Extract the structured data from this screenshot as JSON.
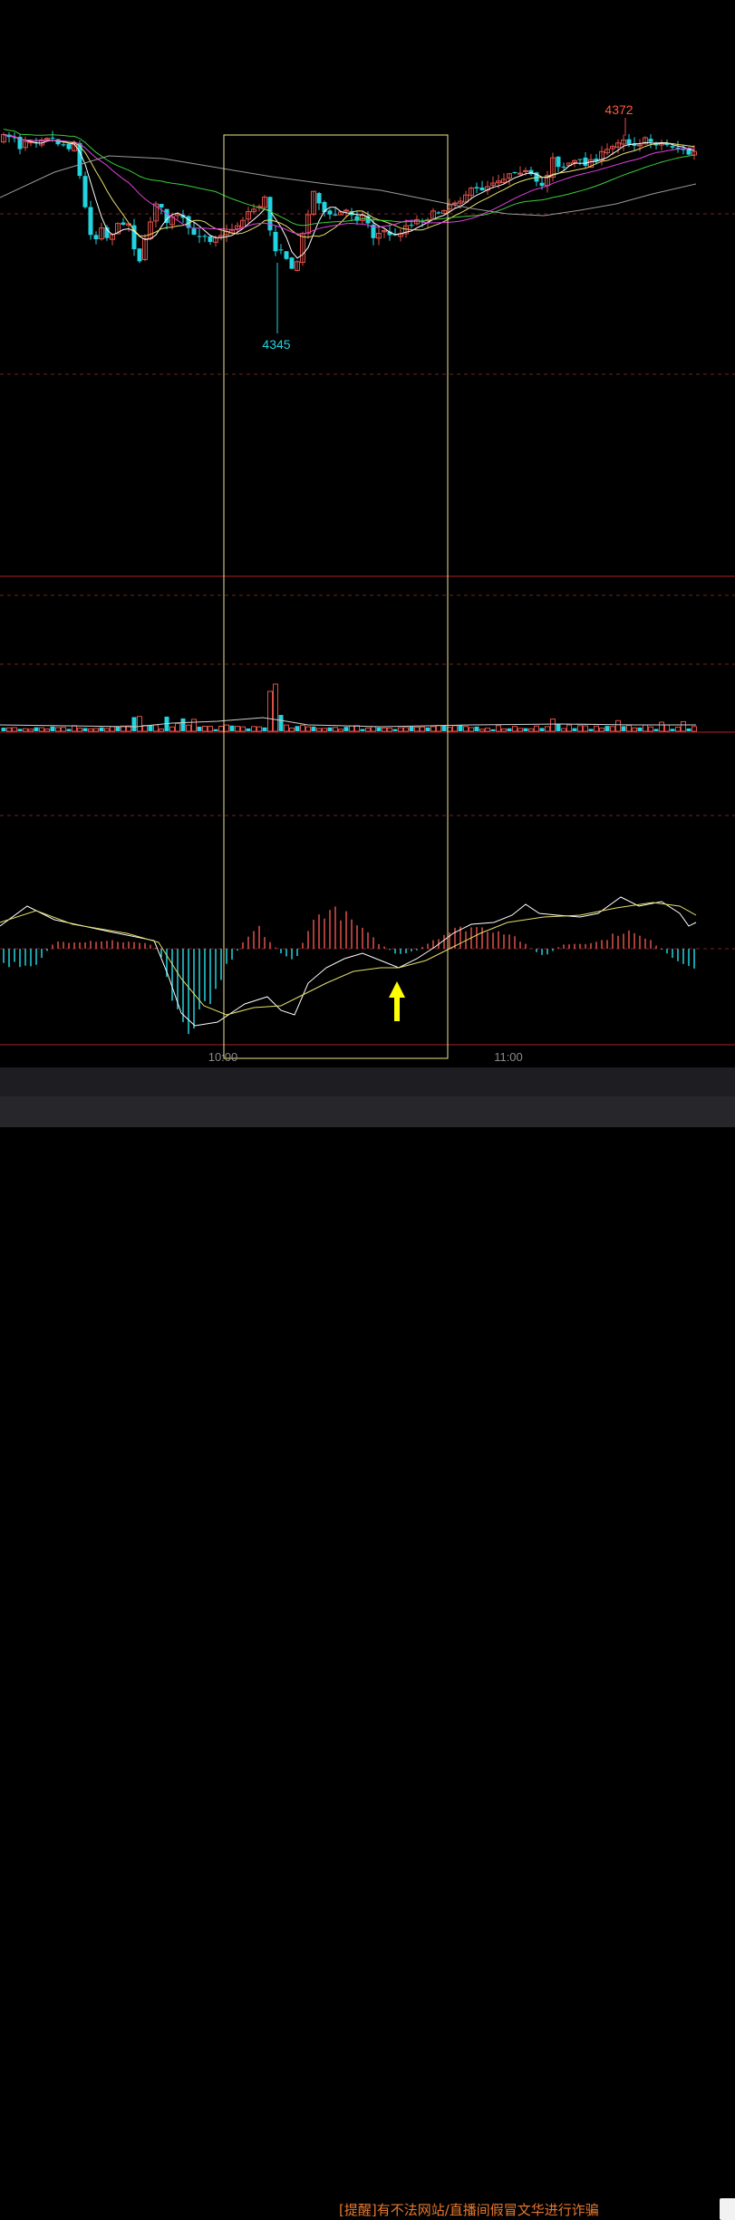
{
  "colors": {
    "background": "#000000",
    "up": "#e0504a",
    "down": "#22d3e0",
    "ma5": "#ffffff",
    "ma10": "#e6e06a",
    "ma20": "#e040e0",
    "ma60": "#3ccc3c",
    "ma120": "#9a9a9a",
    "highlight_box": "#f0e68c",
    "arrow": "#ffff00",
    "panel_line": "#b02020",
    "dashed_line": "#7a1f1f"
  },
  "chart_data": {
    "type": "candlestick",
    "price_high_label": "4372",
    "price_low_label": "4345",
    "x_tick_labels": [
      "10:00",
      "11:00"
    ],
    "panels": [
      "price",
      "volume",
      "macd"
    ],
    "highlight_box": {
      "from": "10:00",
      "to": "10:47"
    },
    "arrow_annotation": {
      "panel": "macd",
      "direction": "up",
      "time": "10:36"
    },
    "bars": 128
  },
  "footer": {
    "warning_text": "[提醒]有不法网站/直播间假冒文华进行诈骗"
  }
}
